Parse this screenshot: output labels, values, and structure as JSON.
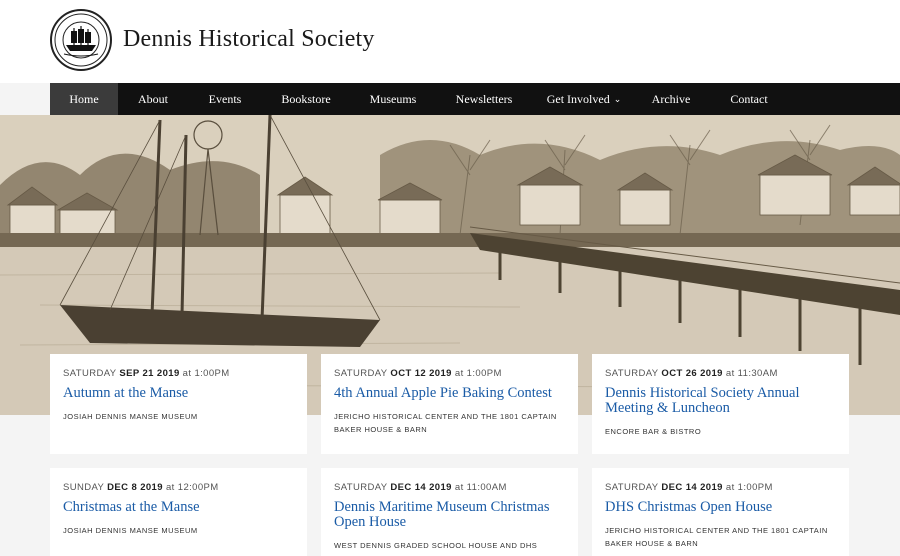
{
  "site": {
    "title": "Dennis Historical Society",
    "logo_icon": "ship-seal-icon"
  },
  "nav": {
    "items": [
      {
        "label": "Home",
        "active": true
      },
      {
        "label": "About"
      },
      {
        "label": "Events"
      },
      {
        "label": "Bookstore"
      },
      {
        "label": "Museums"
      },
      {
        "label": "Newsletters"
      },
      {
        "label": "Get Involved",
        "has_dropdown": true
      },
      {
        "label": "Archive"
      },
      {
        "label": "Contact"
      }
    ],
    "dropdown_icon": "chevron-down-icon"
  },
  "hero": {
    "image": "sepia-harbor-photo",
    "accent_color": "#1a5ba6"
  },
  "events": [
    {
      "day": "SATURDAY",
      "date": "SEP 21 2019",
      "at": "at",
      "time": "1:00PM",
      "title": "Autumn at the Manse",
      "venue": "JOSIAH DENNIS MANSE MUSEUM"
    },
    {
      "day": "SATURDAY",
      "date": "OCT 12 2019",
      "at": "at",
      "time": "1:00PM",
      "title": "4th Annual Apple Pie Baking Contest",
      "venue": "JERICHO HISTORICAL CENTER AND THE 1801 CAPTAIN BAKER HOUSE & BARN"
    },
    {
      "day": "SATURDAY",
      "date": "OCT 26 2019",
      "at": "at",
      "time": "11:30AM",
      "title": "Dennis Historical Society Annual Meeting & Luncheon",
      "venue": "ENCORE BAR & BISTRO"
    },
    {
      "day": "SUNDAY",
      "date": "DEC 8 2019",
      "at": "at",
      "time": "12:00PM",
      "title": "Christmas at the Manse",
      "venue": "JOSIAH DENNIS MANSE MUSEUM"
    },
    {
      "day": "SATURDAY",
      "date": "DEC 14 2019",
      "at": "at",
      "time": "11:00AM",
      "title": "Dennis Maritime Museum Christmas Open House",
      "venue": "WEST DENNIS GRADED SCHOOL HOUSE AND DHS MARITIME"
    },
    {
      "day": "SATURDAY",
      "date": "DEC 14 2019",
      "at": "at",
      "time": "1:00PM",
      "title": "DHS Christmas Open House",
      "venue": "JERICHO HISTORICAL CENTER AND THE 1801 CAPTAIN BAKER HOUSE & BARN"
    }
  ]
}
